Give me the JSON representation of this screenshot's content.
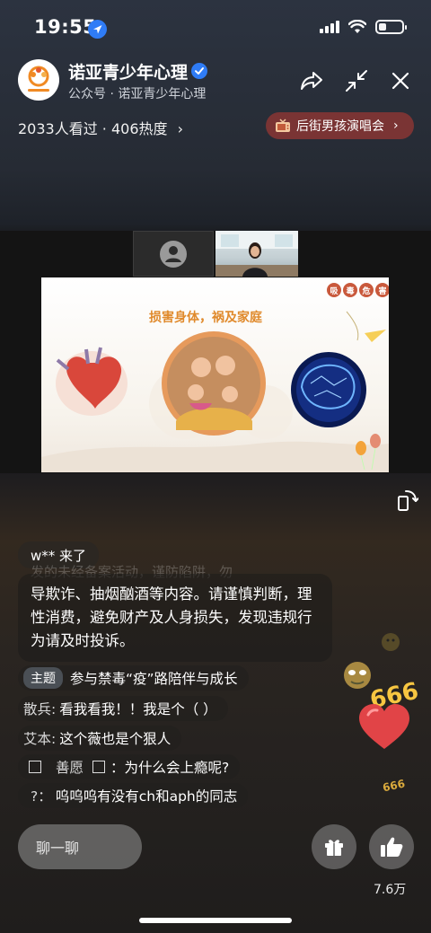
{
  "status_bar": {
    "time": "19:55"
  },
  "header": {
    "account_name": "诺亚青少年心理",
    "account_sub": "公众号 · 诺亚青少年心理",
    "stats": "2033人看过 · 406热度",
    "stats_arrow": "›",
    "concert_label": "后街男孩演唱会",
    "concert_arrow": "›"
  },
  "slide": {
    "title": "损害身体，祸及家庭",
    "badges": [
      "吸",
      "毒",
      "危",
      "害"
    ]
  },
  "chat": {
    "join_message": "w** 来了",
    "notice_faded": "发的未经备案活动，谨防陷阱，勿",
    "notice_text": "导欺诈、抽烟酗酒等内容。请谨慎判断，理性消费，避免财产及人身损失，发现违规行为请及时投诉。",
    "topic_tag": "主题",
    "topic_text": "参与禁毒“疫”路陪伴与成长",
    "comments": [
      {
        "user": "散兵:",
        "text": "看我看我！！我是个（  ）"
      },
      {
        "user": "艾本:",
        "text": "这个薇也是个狠人"
      },
      {
        "user": "善愿",
        "text": "：为什么会上瘾呢?"
      },
      {
        "user": "?：",
        "text": "呜呜呜有没有ch和aph的同志"
      }
    ]
  },
  "footer": {
    "input_placeholder": "聊一聊",
    "like_count": "7.6万"
  },
  "effects": {
    "counter_text": "666",
    "counter_text_small": "666"
  },
  "colors": {
    "accent_blue": "#2f7cf6",
    "concert_bg": "#7a3434",
    "slide_title": "#e08a2c"
  }
}
